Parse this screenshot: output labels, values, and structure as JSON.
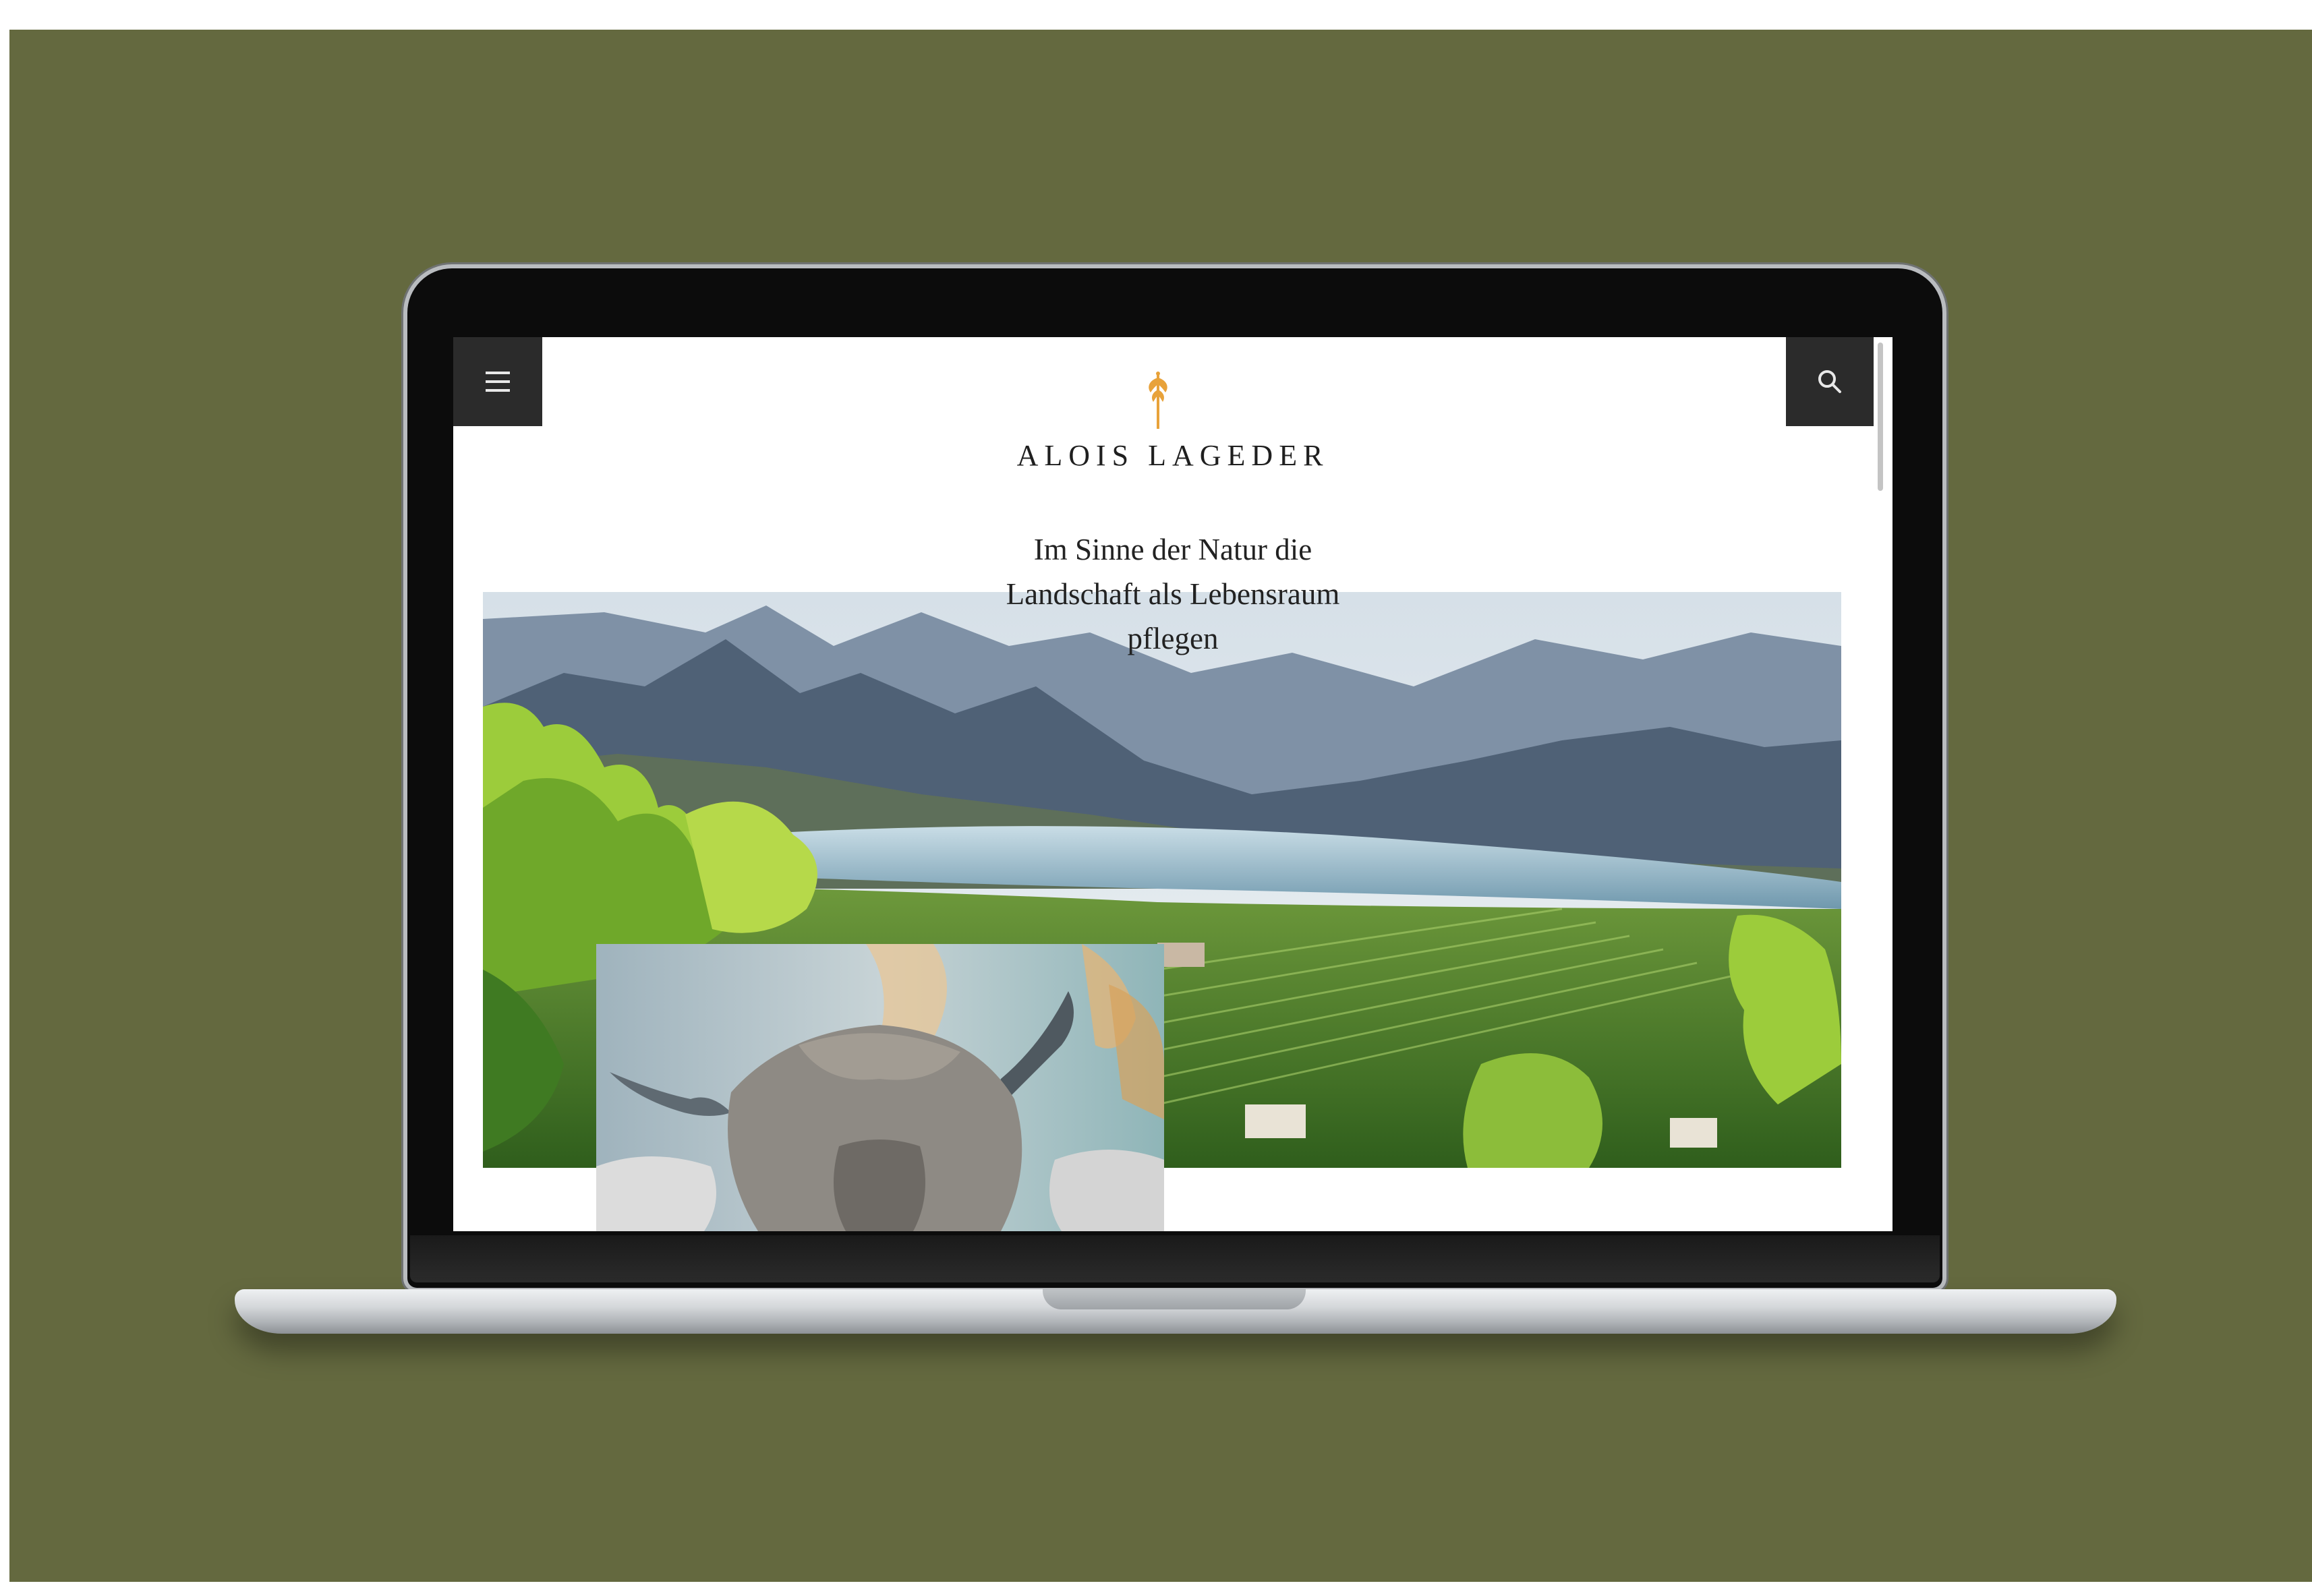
{
  "site": {
    "brand_name": "ALOIS LAGEDER",
    "headline_line1": "Im Sinne der Natur die",
    "headline_line2": "Landschaft als Lebensraum",
    "headline_line3": "pflegen"
  },
  "header": {
    "menu_icon": "hamburger-icon",
    "search_icon": "search-icon",
    "logo_icon": "vine-logo-icon"
  },
  "images": {
    "hero": "vineyard-lake-landscape",
    "feature": "cow-with-horns"
  },
  "colors": {
    "backdrop": "#64693f",
    "header_buttons": "#2b2b2b",
    "logo_accent": "#e8a23a"
  }
}
